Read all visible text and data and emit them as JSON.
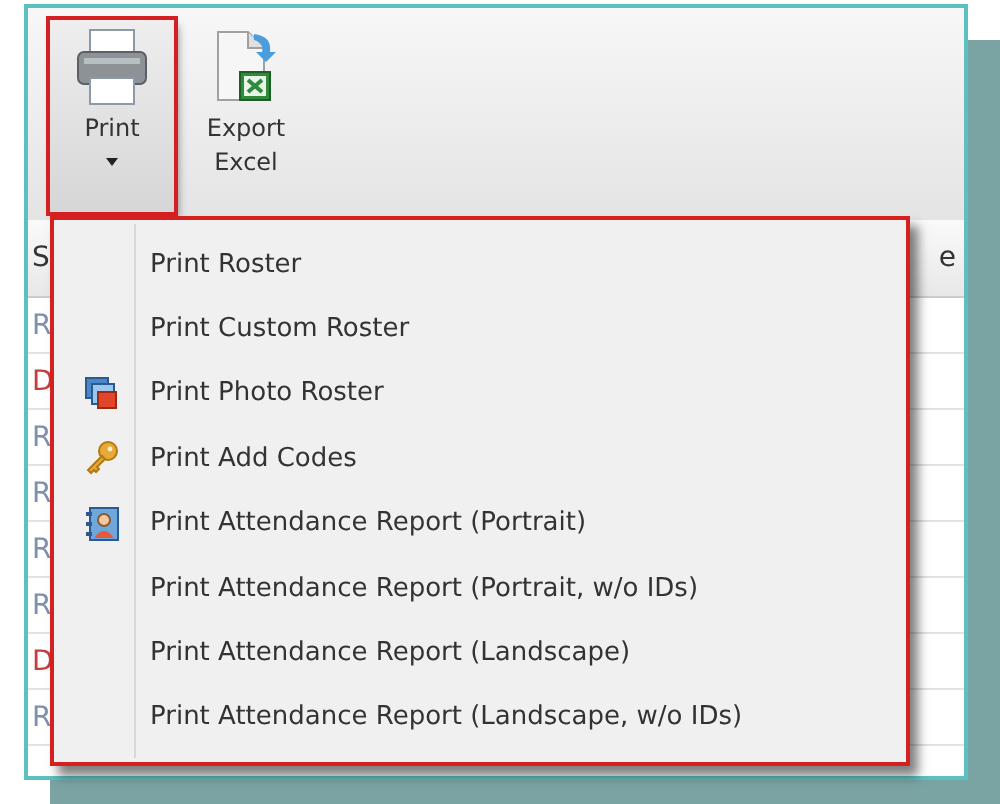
{
  "toolbar": {
    "buttons": [
      {
        "label": "Print",
        "kind": "dropdown",
        "highlighted": true
      },
      {
        "label": "Export Excel",
        "kind": "export",
        "highlighted": false
      }
    ]
  },
  "table": {
    "columns": [
      {
        "label": "S"
      },
      {
        "label": "e"
      }
    ],
    "rows": [
      {
        "column_1": "R",
        "color": "#7f90ad"
      },
      {
        "column_1": "D",
        "color": "#c83c3c"
      },
      {
        "column_1": "R",
        "color": "#7f90ad"
      },
      {
        "column_1": "R",
        "color": "#7f90ad"
      },
      {
        "column_1": "R",
        "color": "#7f90ad"
      },
      {
        "column_1": "R",
        "color": "#7f90ad"
      },
      {
        "column_1": "D",
        "color": "#c83c3c"
      },
      {
        "column_1": "R",
        "color": "#7f90ad"
      }
    ]
  },
  "menu": {
    "highlighted": true,
    "items": [
      {
        "label": "Print Roster",
        "kind": "plain"
      },
      {
        "label": "Print Custom Roster",
        "kind": "plain"
      },
      {
        "label": "Print Photo Roster",
        "kind": "photo"
      },
      {
        "label": "Print Add Codes",
        "kind": "key"
      },
      {
        "label": "Print Attendance Report (Portrait)",
        "kind": "contact"
      },
      {
        "label": "Print Attendance Report (Portrait, w/o IDs)",
        "kind": "plain"
      },
      {
        "label": "Print Attendance Report (Landscape)",
        "kind": "plain"
      },
      {
        "label": "Print Attendance Report (Landscape, w/o IDs)",
        "kind": "plain"
      }
    ]
  }
}
